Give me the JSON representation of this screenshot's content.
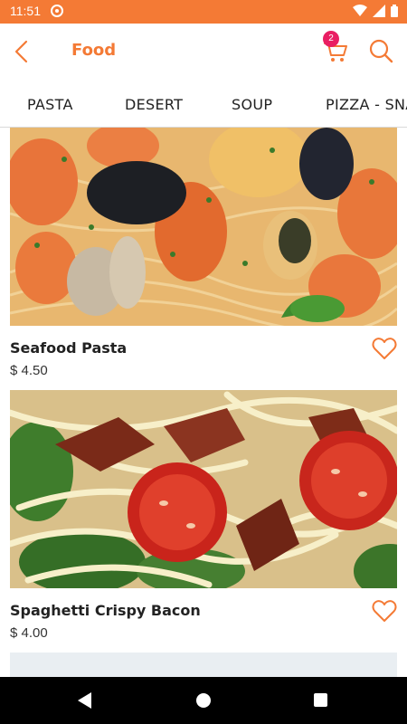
{
  "status_bar": {
    "time": "11:51"
  },
  "app_bar": {
    "title": "Food",
    "cart_count": "2"
  },
  "tabs": [
    "PASTA",
    "DESERT",
    "SOUP",
    "PIZZA - SNA"
  ],
  "products": [
    {
      "name": "Seafood Pasta",
      "price": "$ 4.50"
    },
    {
      "name": "Spaghetti Crispy Bacon",
      "price": "$ 4.00"
    }
  ],
  "colors": {
    "accent": "#f47a35",
    "badge": "#e91e63"
  },
  "icons": [
    "back-arrow-icon",
    "cart-icon",
    "search-icon",
    "heart-icon"
  ]
}
